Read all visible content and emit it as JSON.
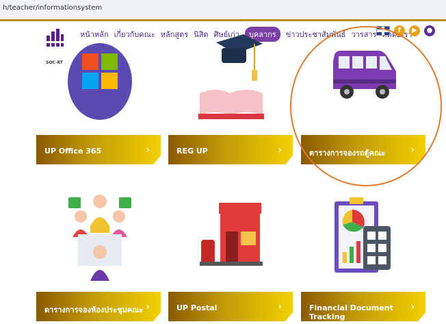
{
  "browser": {
    "url": "h/teacher/informationsystem"
  },
  "nav": {
    "items": [
      "หน้าหลัก",
      "เกี่ยวกับคณะ",
      "หลักสูตร",
      "นิสิต",
      "ศิษย์เก่า",
      "บุคลากร",
      "ข่าวประชาสัมพันธ์",
      "วารสาร",
      "ติดต่อเรา"
    ],
    "active_index": 5
  },
  "language": {
    "icon": "uk-flag-icon"
  },
  "logo": {
    "subtitle": "SOC-RT"
  },
  "cards": [
    {
      "label": "UP Office 365",
      "arrow": "›",
      "icon": "office365-icon"
    },
    {
      "label": "REG UP",
      "arrow": "›",
      "icon": "graduation-book-icon"
    },
    {
      "label": "ตารางการจองรถตู้คณะ",
      "arrow": "›",
      "icon": "van-icon"
    },
    {
      "label": "ตารางการจองห้องประชุมคณะ",
      "arrow": "›",
      "icon": "meeting-people-icon"
    },
    {
      "label": "UP Postal",
      "arrow": "›",
      "icon": "postal-store-icon"
    },
    {
      "label": "Financial Document Tracking",
      "arrow": "›",
      "icon": "finance-report-icon"
    }
  ],
  "colors": {
    "accent": "#7b3fa6",
    "gold": "#c29b08",
    "annotation": "#e07a2f"
  }
}
